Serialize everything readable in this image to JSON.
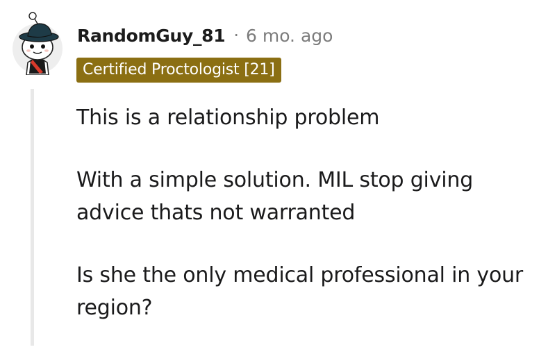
{
  "comment": {
    "avatar_icon": "snoo-avatar-with-hat-icon",
    "username": "RandomGuy_81",
    "separator": "·",
    "timestamp": "6 mo. ago",
    "flair": "Certified Proctologist [21]",
    "flair_color": "#8b6f13",
    "paragraphs": [
      "This is a relationship problem",
      "With a simple solution. MIL stop giving advice thats not warranted",
      "Is she the only medical professional in your region?"
    ]
  }
}
